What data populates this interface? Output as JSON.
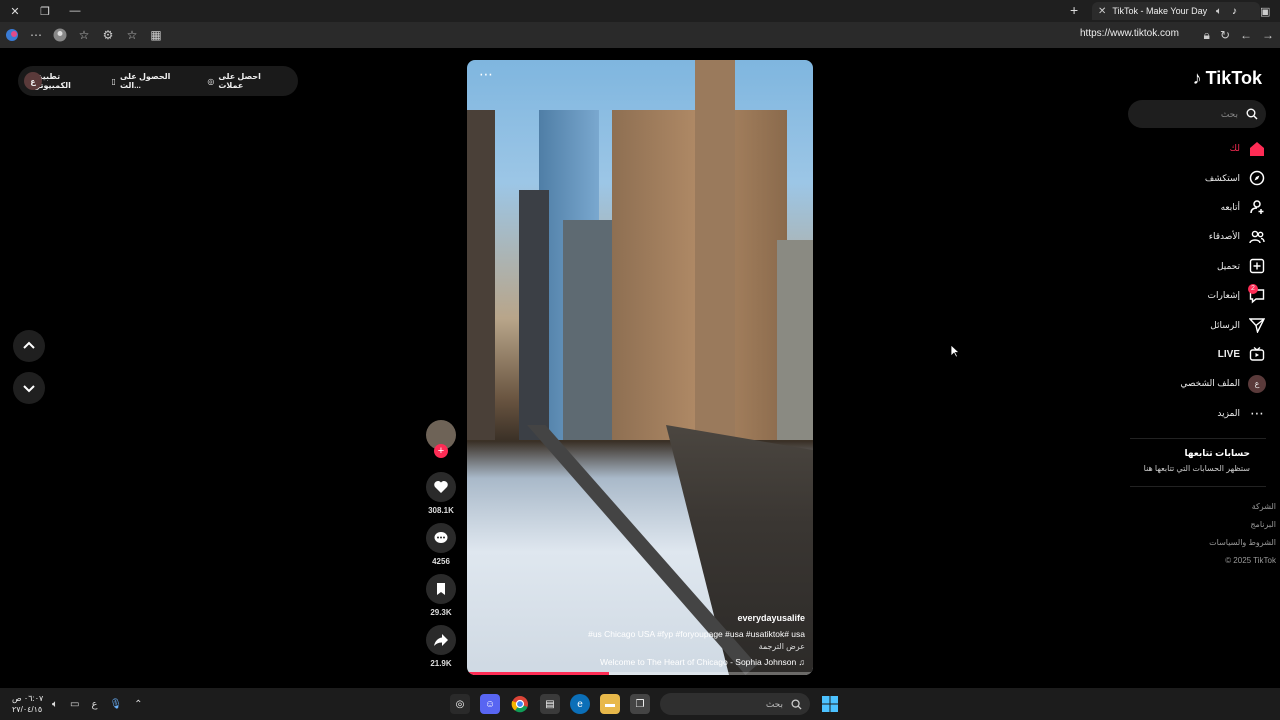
{
  "browser": {
    "tab_title": "TikTok - Make Your Day",
    "url": "https://www.tiktok.com"
  },
  "promo": {
    "avatar_letter": "ع",
    "item1": "احصل على عملات",
    "item2": "الحصول على الت...",
    "item3": "تطبيق الكمبيوتر"
  },
  "video": {
    "progress": 0.41,
    "username": "everydayusalife",
    "caption": "us Chicago USA #fyp #foryoupage #usa #usatiktok# usa#",
    "caption_more": "عرض الترجمة",
    "music": "Welcome to The Heart of Chicago - Sophia Johnson ♫"
  },
  "actions": {
    "likes": "308.1K",
    "comments": "4256",
    "saves": "29.3K",
    "shares": "21.9K"
  },
  "sidebar": {
    "logo": "TikTok",
    "search_placeholder": "بحث",
    "items": [
      {
        "label": "لك",
        "icon": "home-icon"
      },
      {
        "label": "استكشف",
        "icon": "compass-icon"
      },
      {
        "label": "أتابعه",
        "icon": "user-follow-icon"
      },
      {
        "label": "الأصدقاء",
        "icon": "friends-icon"
      },
      {
        "label": "تحميل",
        "icon": "upload-icon"
      },
      {
        "label": "إشعارات",
        "icon": "inbox-icon",
        "badge": "2"
      },
      {
        "label": "الرسائل",
        "icon": "send-icon"
      },
      {
        "label": "LIVE",
        "icon": "live-tv-icon"
      },
      {
        "label": "الملف الشخصي",
        "icon": "avatar",
        "avatar_letter": "ع"
      },
      {
        "label": "المزيد",
        "icon": "more-icon"
      }
    ],
    "following_heading": "حسابات تتابعها",
    "following_sub": "ستظهر الحسابات التي تتابعها هنا",
    "footer": [
      "الشركة",
      "البرنامج",
      "الشروط والسياسات",
      "© 2025 TikTok"
    ]
  },
  "taskbar": {
    "time": "٠٦:٠٧ ص",
    "date": "٢٧/٠٤/١٥",
    "lang": "ع",
    "search_placeholder": "بحث"
  }
}
